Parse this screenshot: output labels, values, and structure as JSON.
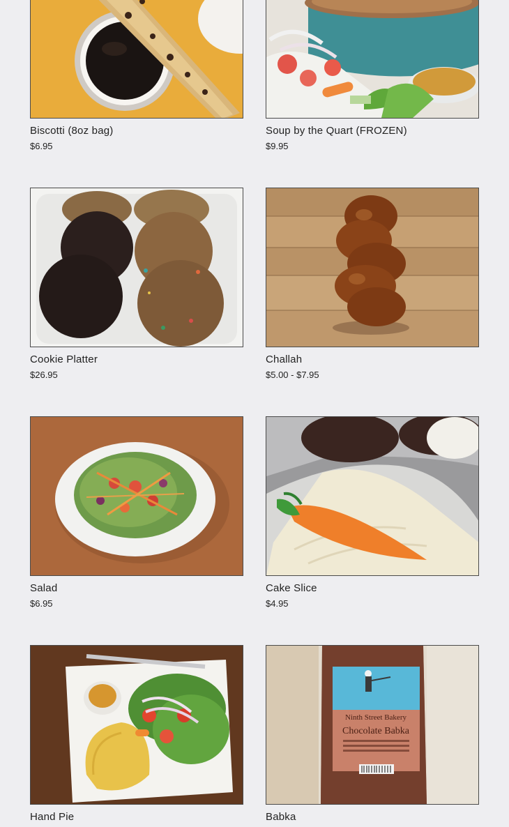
{
  "products": [
    {
      "name": "Biscotti (8oz bag)",
      "price": "$6.95",
      "image": "biscotti-photo"
    },
    {
      "name": "Soup by the Quart (FROZEN)",
      "price": "$9.95",
      "image": "soup-photo"
    },
    {
      "name": "Cookie Platter",
      "price": "$26.95",
      "image": "cookie-platter-photo"
    },
    {
      "name": "Challah",
      "price": "$5.00 - $7.95",
      "image": "challah-photo"
    },
    {
      "name": "Salad",
      "price": "$6.95",
      "image": "salad-photo"
    },
    {
      "name": "Cake Slice",
      "price": "$4.95",
      "image": "cake-slice-photo"
    },
    {
      "name": "Hand Pie",
      "price": "",
      "image": "hand-pie-photo"
    },
    {
      "name": "Babka",
      "price": "",
      "image": "babka-photo"
    }
  ],
  "babka_label": {
    "brand": "Ninth Street Bakery",
    "product": "Chocolate Babka"
  }
}
